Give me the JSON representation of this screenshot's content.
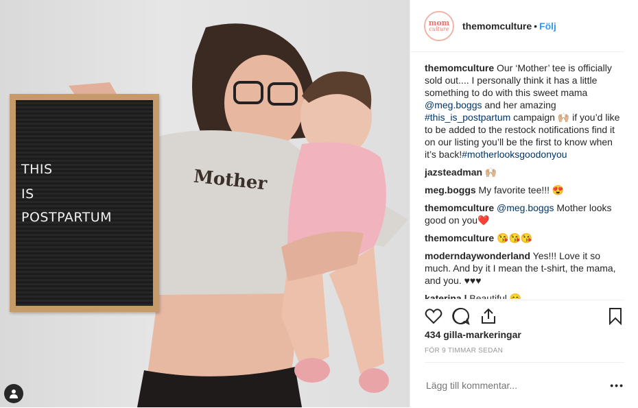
{
  "photo": {
    "board_lines": [
      "THIS",
      "IS",
      "POSTPARTUM"
    ],
    "shirt_text": "Mother"
  },
  "header": {
    "avatar_line1": "mom",
    "avatar_line2": "culture",
    "username": "themomculture",
    "separator": "•",
    "follow_label": "Följ"
  },
  "comments": [
    {
      "user": "themomculture",
      "text_parts": [
        {
          "t": " Our ‘Mother’ tee is officially sold out.... I personally think it has a little something to do with this sweet mama "
        },
        {
          "link": "@meg.boggs"
        },
        {
          "t": " and her amazing "
        },
        {
          "link": "#this_is_postpartum"
        },
        {
          "t": " campaign 🙌🏼 if you’d like to be added to the restock notifications find it on our listing you’ll be the first to know when it’s back!"
        },
        {
          "link": "#motherlooksgoodonyou"
        }
      ]
    },
    {
      "user": "jazsteadman",
      "text_parts": [
        {
          "t": " 🙌🏼"
        }
      ]
    },
    {
      "user": "meg.boggs",
      "text_parts": [
        {
          "t": " My favorite tee!!! 😍"
        }
      ]
    },
    {
      "user": "themomculture",
      "text_parts": [
        {
          "link": " @meg.boggs"
        },
        {
          "t": " Mother looks good on you❤️"
        }
      ]
    },
    {
      "user": "themomculture",
      "text_parts": [
        {
          "t": " 😘😘😘"
        }
      ]
    },
    {
      "user": "moderndaywonderland",
      "text_parts": [
        {
          "t": " Yes!!! Love it so much. And by it I mean the t-shirt, the mama, and you. ♥♥♥"
        }
      ]
    },
    {
      "user": "katerina.l",
      "text_parts": [
        {
          "t": " Beautiful 😊"
        }
      ]
    }
  ],
  "actions": {
    "like_icon": "heart-icon",
    "comment_icon": "comment-icon",
    "share_icon": "share-icon",
    "save_icon": "bookmark-icon"
  },
  "likes_text": "434 gilla-markeringar",
  "time_text": "FÖR 9 TIMMAR SEDAN",
  "add_comment": {
    "placeholder": "Lägg till kommentar...",
    "more_label": "•••"
  },
  "colors": {
    "accent": "#3897f0",
    "link": "#003569",
    "brand": "#e8756a"
  }
}
